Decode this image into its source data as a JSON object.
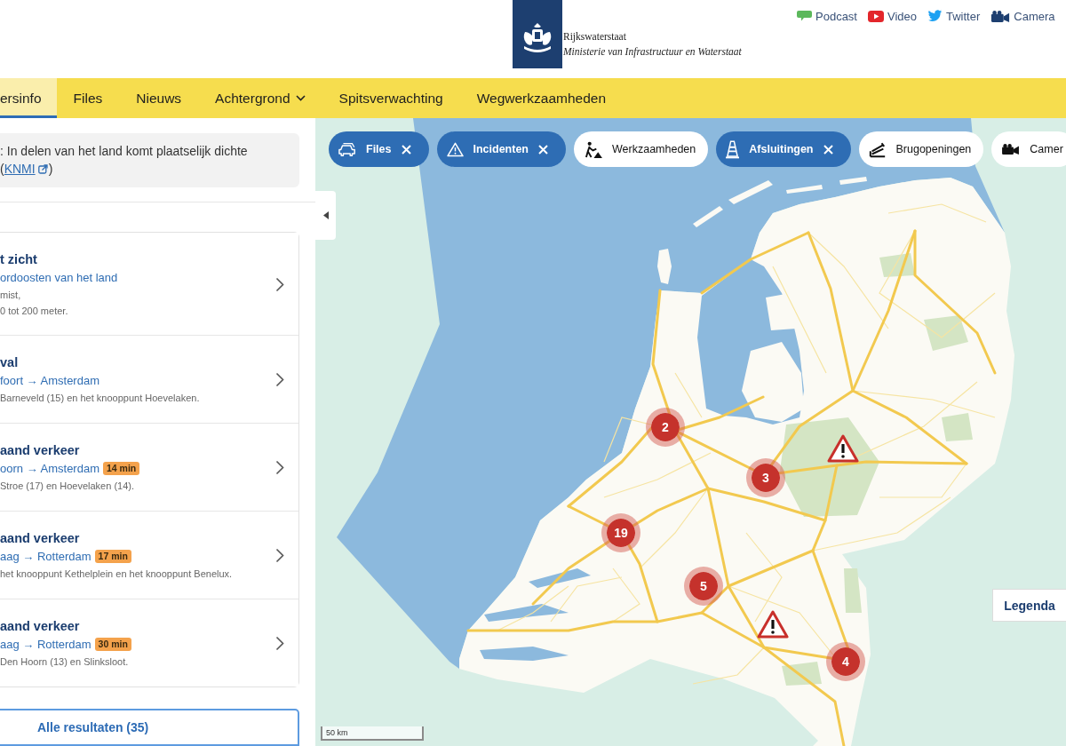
{
  "header": {
    "brand": {
      "name": "Rijkswaterstaat",
      "subtitle": "Ministerie van Infrastructuur en Waterstaat"
    },
    "links": [
      {
        "label": "Podcast"
      },
      {
        "label": "Video"
      },
      {
        "label": "Twitter"
      },
      {
        "label": "Camera"
      }
    ]
  },
  "nav": [
    {
      "label": "ersinfo",
      "selected": true,
      "dropdown": false
    },
    {
      "label": "Files",
      "selected": false,
      "dropdown": false
    },
    {
      "label": "Nieuws",
      "selected": false,
      "dropdown": false
    },
    {
      "label": "Achtergrond",
      "selected": false,
      "dropdown": true
    },
    {
      "label": "Spitsverwachting",
      "selected": false,
      "dropdown": false
    },
    {
      "label": "Wegwerkzaamheden",
      "selected": false,
      "dropdown": false
    }
  ],
  "notice": {
    "text": ": In delen van het land komt plaatselijk dichte",
    "link_open": "(",
    "link": "KNMI",
    "link_close": ")"
  },
  "results": [
    {
      "title": "t zicht",
      "route": "ordoosten van het land",
      "description": "mist,\n0 tot 200 meter."
    },
    {
      "title": "val",
      "route": "foort → Amsterdam",
      "description": "Barneveld (15) en het knooppunt Hoevelaken."
    },
    {
      "title": "aand verkeer",
      "route": "oorn → Amsterdam",
      "delay": "14 min",
      "description": "Stroe (17) en Hoevelaken (14)."
    },
    {
      "title": "aand verkeer",
      "route": "aag → Rotterdam",
      "delay": "17 min",
      "description": "het knooppunt Kethelplein en het knooppunt Benelux."
    },
    {
      "title": "aand verkeer",
      "route": "aag → Rotterdam",
      "delay": "30 min",
      "description": "Den Hoorn (13) en Slinksloot."
    }
  ],
  "all_results_button": "Alle resultaten (35)",
  "map": {
    "filters": [
      {
        "label": "Files",
        "selected": true
      },
      {
        "label": "Incidenten",
        "selected": true
      },
      {
        "label": "Werkzaamheden",
        "selected": false
      },
      {
        "label": "Afsluitingen",
        "selected": true
      },
      {
        "label": "Brugopeningen",
        "selected": false
      },
      {
        "label": "Camer",
        "selected": false
      }
    ],
    "markers": [
      {
        "kind": "cluster",
        "count": "2"
      },
      {
        "kind": "warning"
      },
      {
        "kind": "cluster",
        "count": "3"
      },
      {
        "kind": "cluster",
        "count": "19"
      },
      {
        "kind": "cluster",
        "count": "5"
      },
      {
        "kind": "warning"
      },
      {
        "kind": "cluster",
        "count": "4"
      }
    ],
    "legend_button": "Legenda",
    "scale": "50 km"
  }
}
